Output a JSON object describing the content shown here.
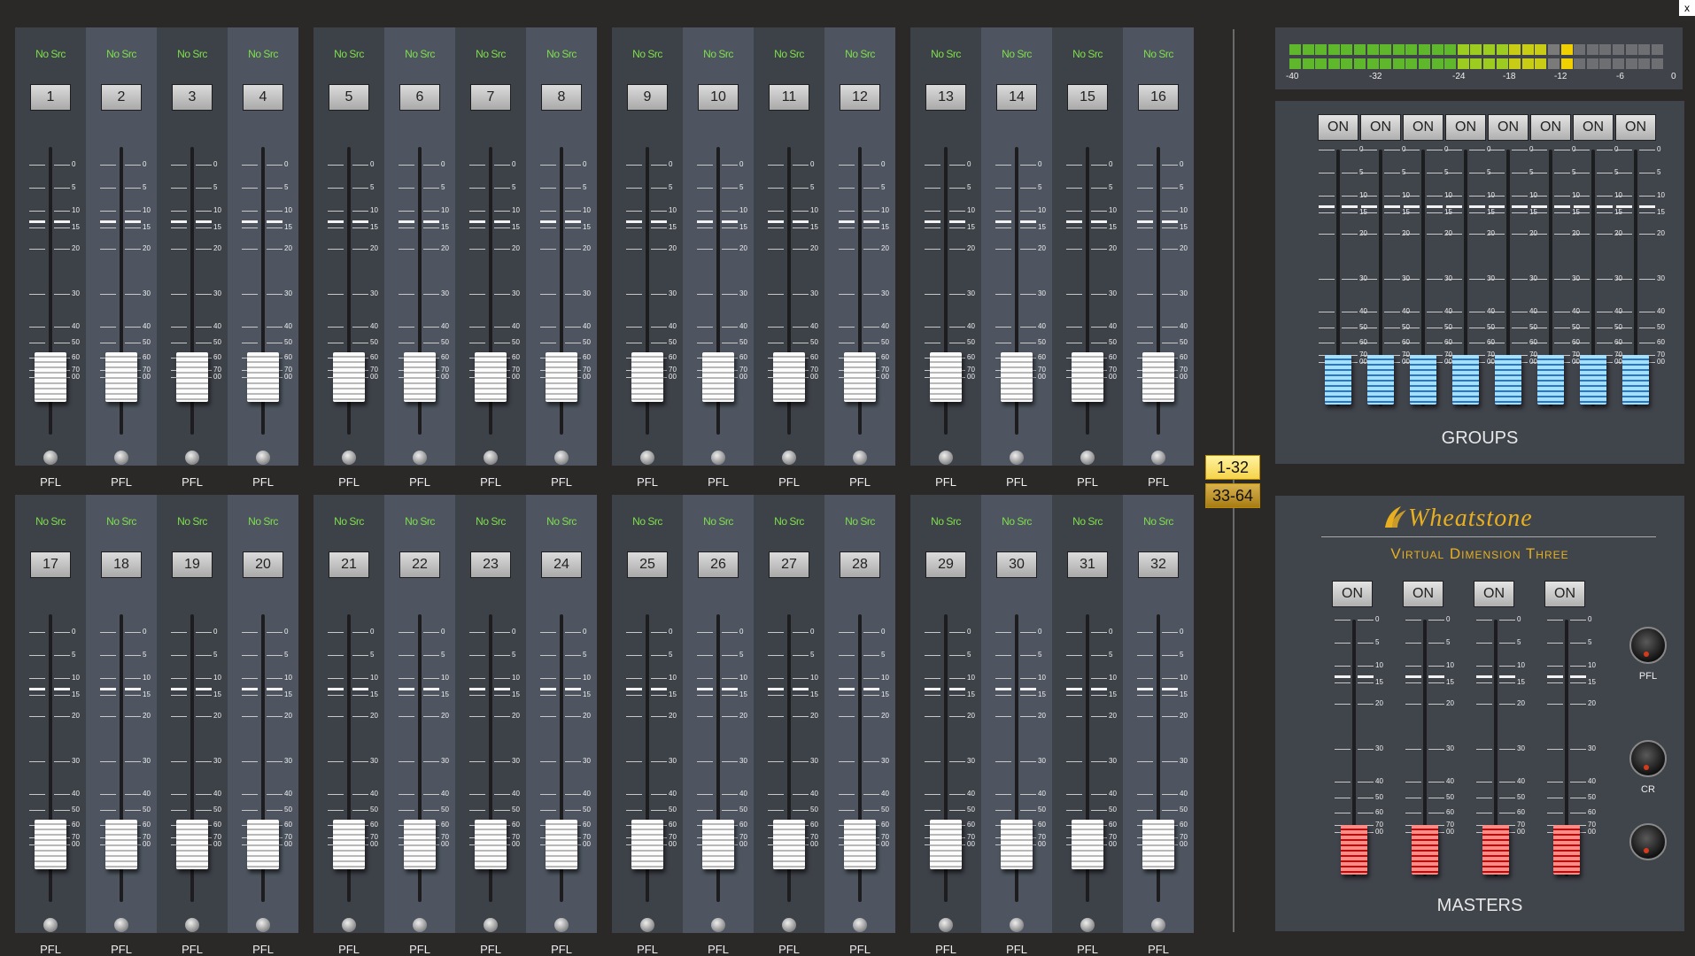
{
  "channels": [
    {
      "num": "1",
      "src": "No Src",
      "pfl": "PFL"
    },
    {
      "num": "2",
      "src": "No Src",
      "pfl": "PFL"
    },
    {
      "num": "3",
      "src": "No Src",
      "pfl": "PFL"
    },
    {
      "num": "4",
      "src": "No Src",
      "pfl": "PFL"
    },
    {
      "num": "5",
      "src": "No Src",
      "pfl": "PFL"
    },
    {
      "num": "6",
      "src": "No Src",
      "pfl": "PFL"
    },
    {
      "num": "7",
      "src": "No Src",
      "pfl": "PFL"
    },
    {
      "num": "8",
      "src": "No Src",
      "pfl": "PFL"
    },
    {
      "num": "9",
      "src": "No Src",
      "pfl": "PFL"
    },
    {
      "num": "10",
      "src": "No Src",
      "pfl": "PFL"
    },
    {
      "num": "11",
      "src": "No Src",
      "pfl": "PFL"
    },
    {
      "num": "12",
      "src": "No Src",
      "pfl": "PFL"
    },
    {
      "num": "13",
      "src": "No Src",
      "pfl": "PFL"
    },
    {
      "num": "14",
      "src": "No Src",
      "pfl": "PFL"
    },
    {
      "num": "15",
      "src": "No Src",
      "pfl": "PFL"
    },
    {
      "num": "16",
      "src": "No Src",
      "pfl": "PFL"
    },
    {
      "num": "17",
      "src": "No Src",
      "pfl": "PFL"
    },
    {
      "num": "18",
      "src": "No Src",
      "pfl": "PFL"
    },
    {
      "num": "19",
      "src": "No Src",
      "pfl": "PFL"
    },
    {
      "num": "20",
      "src": "No Src",
      "pfl": "PFL"
    },
    {
      "num": "21",
      "src": "No Src",
      "pfl": "PFL"
    },
    {
      "num": "22",
      "src": "No Src",
      "pfl": "PFL"
    },
    {
      "num": "23",
      "src": "No Src",
      "pfl": "PFL"
    },
    {
      "num": "24",
      "src": "No Src",
      "pfl": "PFL"
    },
    {
      "num": "25",
      "src": "No Src",
      "pfl": "PFL"
    },
    {
      "num": "26",
      "src": "No Src",
      "pfl": "PFL"
    },
    {
      "num": "27",
      "src": "No Src",
      "pfl": "PFL"
    },
    {
      "num": "28",
      "src": "No Src",
      "pfl": "PFL"
    },
    {
      "num": "29",
      "src": "No Src",
      "pfl": "PFL"
    },
    {
      "num": "30",
      "src": "No Src",
      "pfl": "PFL"
    },
    {
      "num": "31",
      "src": "No Src",
      "pfl": "PFL"
    },
    {
      "num": "32",
      "src": "No Src",
      "pfl": "PFL"
    }
  ],
  "fader_scale": [
    "0",
    "5",
    "10",
    "15",
    "20",
    "30",
    "40",
    "50",
    "60",
    "70",
    "00"
  ],
  "meter_scale": [
    "-40",
    "-32",
    "-24",
    "-18",
    "-12",
    "-6",
    "0"
  ],
  "bank_buttons": {
    "active": "1-32",
    "other": "33-64"
  },
  "groups": {
    "title": "GROUPS",
    "on_label": "ON",
    "count_label": "8"
  },
  "masters": {
    "title": "MASTERS",
    "on_label": "ON",
    "brand": "Wheatstone",
    "product": "Virtual Dimension Three",
    "knobs": [
      {
        "label": "PFL"
      },
      {
        "label": "CR"
      },
      {
        "label": ""
      }
    ]
  },
  "window": {
    "close_label": "x"
  },
  "colors": {
    "src_text": "#7de04a",
    "group_fader": "#2a76c2",
    "master_fader": "#b50e0e",
    "bank_active": "#ffe066",
    "brand": "#e8b020"
  }
}
